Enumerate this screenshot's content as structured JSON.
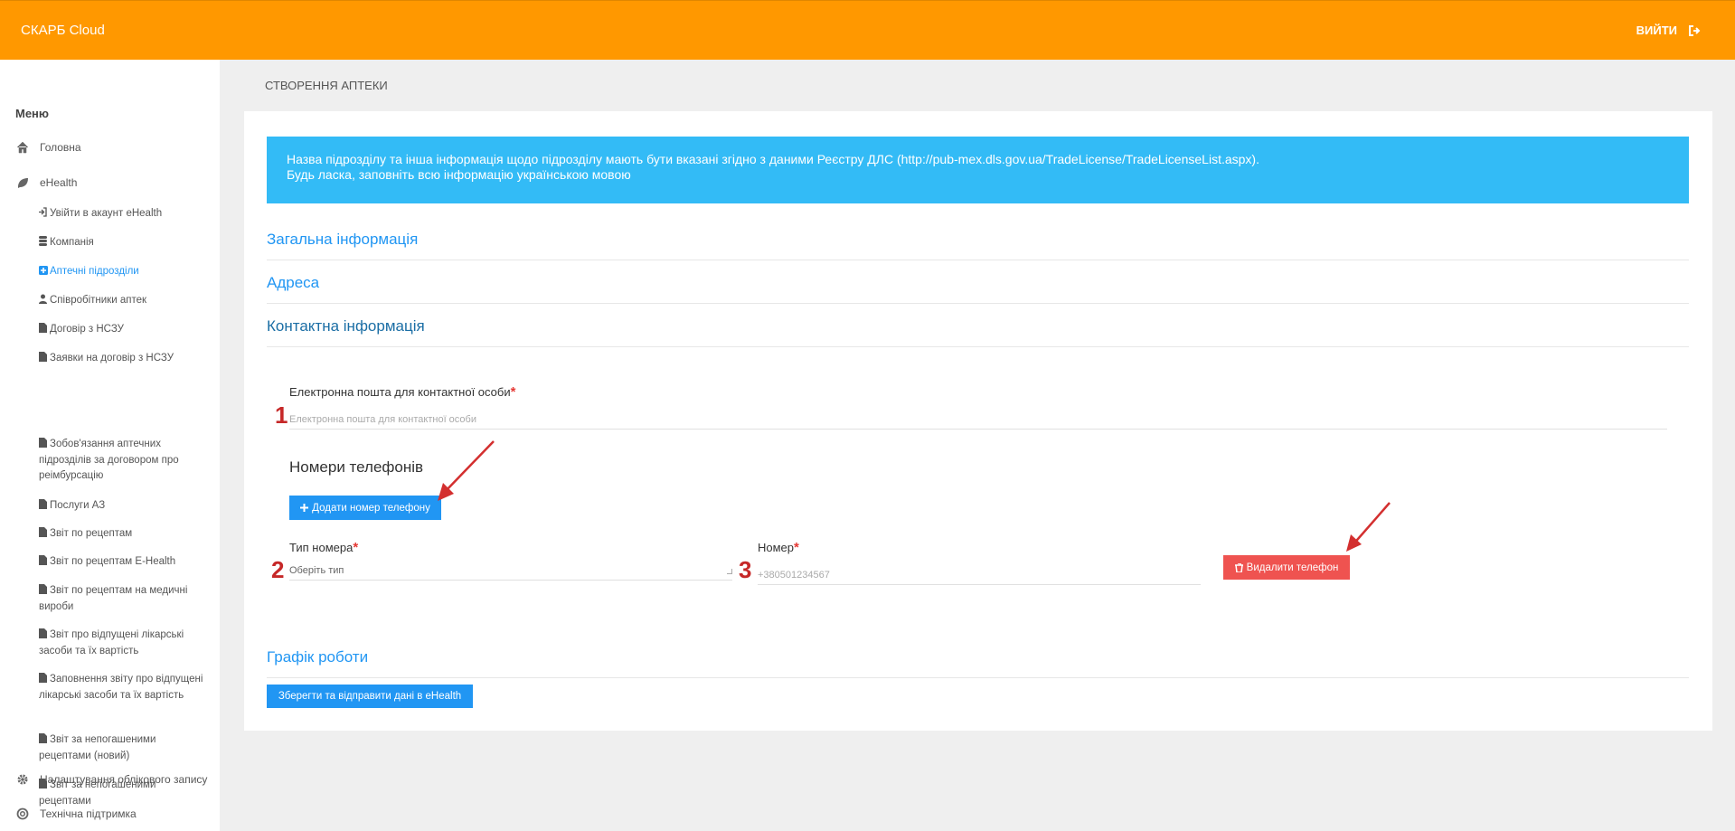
{
  "app": {
    "title": "СКАРБ Cloud",
    "logout_label": "ВИЙТИ"
  },
  "sidebar": {
    "menu_title": "Меню",
    "home": "Головна",
    "ehealth": "eHealth",
    "items": [
      {
        "label": "Увійти в акаунт eHealth"
      },
      {
        "label": "Компанія"
      },
      {
        "label": "Аптечні підрозділи"
      },
      {
        "label": "Співробітники аптек"
      },
      {
        "label": "Договір з НСЗУ"
      },
      {
        "label": "Заявки на договір з НСЗУ"
      },
      {
        "label": "Зобов'язання аптечних підрозділів за договором про реімбурсацію"
      },
      {
        "label": "Послуги АЗ"
      },
      {
        "label": "Звіт по рецептам"
      },
      {
        "label": "Звіт по рецептам E-Health"
      },
      {
        "label": "Звіт по рецептам на медичні вироби"
      },
      {
        "label": "Звіт про відпущені лікарські засоби та їх вартість"
      },
      {
        "label": "Заповнення звіту про відпущені лікарські засоби та їх вартість"
      },
      {
        "label": "Звіт за непогашеними рецептами (новий)"
      },
      {
        "label": "Звіт за непогашеними рецептами"
      }
    ],
    "settings": "Налаштування облікового запису",
    "support": "Технічна підтримка"
  },
  "page": {
    "title": "СТВОРЕННЯ АПТЕКИ",
    "info_line1": "Назва підрозділу та інша інформація щодо підрозділу мають бути вказані згідно з даними Реєстру ДЛС (http://pub-mex.dls.gov.ua/TradeLicense/TradeLicenseList.aspx).",
    "info_line2": "Будь ласка, заповніть всю інформацію українською мовою",
    "sections": {
      "general": "Загальна інформація",
      "address": "Адреса",
      "contact": "Контактна інформація",
      "schedule": "Графік роботи"
    },
    "email_label": "Електронна пошта для контактної особи",
    "email_placeholder": "Електронна пошта для контактної особи",
    "phones_heading": "Номери телефонів",
    "add_phone_button": "Додати номер телефону",
    "phone_type_label": "Тип номера",
    "phone_type_placeholder": "Оберіть тип",
    "phone_number_label": "Номер",
    "phone_number_placeholder": "+380501234567",
    "delete_phone_button": "Видалити телефон",
    "save_button": "Зберегти та відправити дані в eHealth",
    "required_mark": "*"
  },
  "annotations": {
    "n1": "1",
    "n2": "2",
    "n3": "3",
    "arrow_color": "#d32f2f"
  },
  "colors": {
    "topbar": "#ff9800",
    "info": "#33bbf6",
    "primary": "#2196f3",
    "danger": "#ef5350"
  },
  "icons": {
    "logout": "sign-out-icon",
    "home": "home-icon",
    "ehealth": "leaf-icon",
    "settings": "gear-icon",
    "support": "life-ring-icon"
  }
}
